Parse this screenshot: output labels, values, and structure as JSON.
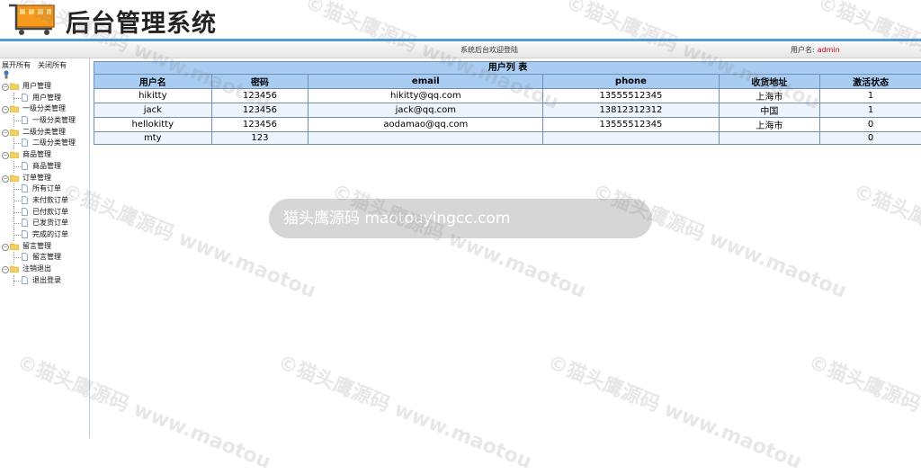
{
  "header": {
    "title": "后台管理系统"
  },
  "subbar": {
    "welcome": "系统后台欢迎登陆",
    "user_label": "用户名:",
    "user_name": "admin"
  },
  "sidebar": {
    "expand_all": "展开所有",
    "collapse_all": "关闭所有",
    "groups": [
      {
        "label": "用户管理",
        "items": [
          "用户管理"
        ]
      },
      {
        "label": "一级分类管理",
        "items": [
          "一级分类管理"
        ]
      },
      {
        "label": "二级分类管理",
        "items": [
          "二级分类管理"
        ]
      },
      {
        "label": "商品管理",
        "items": [
          "商品管理"
        ]
      },
      {
        "label": "订单管理",
        "items": [
          "所有订单",
          "未付款订单",
          "已付款订单",
          "已发货订单",
          "完成的订单"
        ]
      },
      {
        "label": "留言管理",
        "items": [
          "留言管理"
        ]
      },
      {
        "label": "注销退出",
        "items": [
          "退出登录"
        ]
      }
    ]
  },
  "table": {
    "caption": "用户列 表",
    "columns": [
      "用户名",
      "密码",
      "email",
      "phone",
      "收货地址",
      "激活状态"
    ],
    "rows": [
      [
        "hikitty",
        "123456",
        "hikitty@qq.com",
        "13555512345",
        "上海市",
        "1"
      ],
      [
        "jack",
        "123456",
        "jack@qq.com",
        "13812312312",
        "中国",
        "1"
      ],
      [
        "hellokitty",
        "123456",
        "aodamao@qq.com",
        "13555512345",
        "上海市",
        "0"
      ],
      [
        "mty",
        "123",
        "",
        "",
        "",
        "0"
      ]
    ]
  },
  "watermark": {
    "banner": "猫头鹰源码 maotouyingcc.com",
    "text": "©猫头鹰源码 www.maotouyingcc.com"
  },
  "colors": {
    "accent": "#4f9ad8",
    "table_header": "#a9cdf2",
    "username": "#d2001a"
  }
}
